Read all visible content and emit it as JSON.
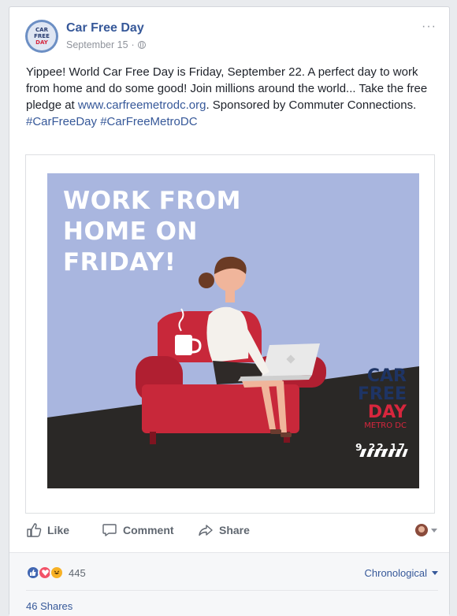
{
  "post": {
    "page_name": "Car Free Day",
    "timestamp": "September 15",
    "separator": "·",
    "more_label": "···",
    "text_intro": "Yippee! World Car Free Day is Friday, September 22. A perfect day to work from home and do some good! Join millions around the world... Take the free pledge at ",
    "link_text": "www.carfreemetrodc.org",
    "text_outro": ". Sponsored by Commuter Connections.",
    "hashtags": "#CarFreeDay #CarFreeMetroDC"
  },
  "avatar": {
    "line1": "CAR",
    "line2": "FREE",
    "line3": "DAY"
  },
  "ad_image": {
    "headline_1": "WORK FROM",
    "headline_2": "HOME ON",
    "headline_3": "FRIDAY!",
    "logo_car": "CAR",
    "logo_free": "FREE",
    "logo_day": "DAY",
    "logo_metro": "METRO DC",
    "logo_date": "9.22.17"
  },
  "actions": {
    "like": "Like",
    "comment": "Comment",
    "share": "Share"
  },
  "reactions": {
    "count": "445",
    "sort_label": "Chronological",
    "shares": "46 Shares"
  },
  "colors": {
    "link": "#365899",
    "image_bg": "#a9b6df",
    "chair": "#c8283a",
    "floor": "#2a2826",
    "logo_navy": "#1e3464",
    "logo_red": "#d7263d"
  },
  "icons": [
    "globe-icon",
    "more-icon",
    "like-icon",
    "comment-icon",
    "share-icon",
    "caret-down-icon"
  ]
}
